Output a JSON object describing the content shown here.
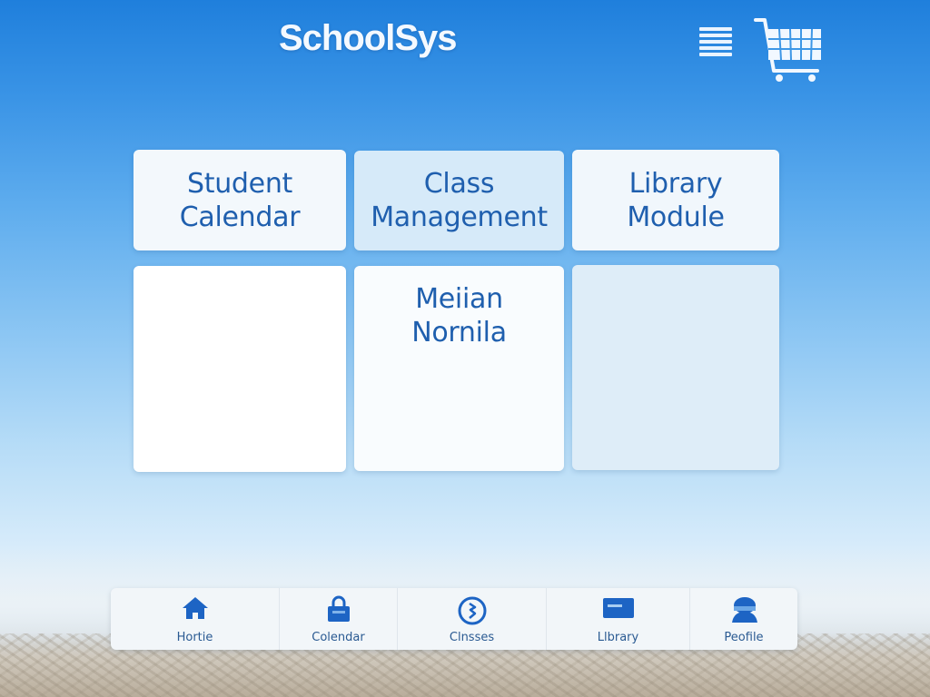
{
  "header": {
    "app_title": "SchoolSys",
    "menu_icon": "hamburger-menu-icon",
    "cart_icon": "shopping-cart-icon"
  },
  "cards": [
    {
      "label": "Student\nCalendar"
    },
    {
      "label": "Class\nManagement"
    },
    {
      "label": "Library\nModule"
    },
    {
      "label": ""
    },
    {
      "label": "Mеiian\nNornila"
    },
    {
      "label": ""
    }
  ],
  "bottom_nav": {
    "items": [
      {
        "label": "Hortie",
        "icon": "home-icon"
      },
      {
        "label": "Colendar",
        "icon": "calendar-lock-icon"
      },
      {
        "label": "Clnsses",
        "icon": "classes-circle-icon"
      },
      {
        "label": "Llbrary",
        "icon": "library-card-icon"
      },
      {
        "label": "Peofile",
        "icon": "profile-icon"
      }
    ]
  },
  "colors": {
    "accent": "#1f5fae",
    "sky_top": "#1f7fdc",
    "nav_icon": "#1d64c4"
  }
}
